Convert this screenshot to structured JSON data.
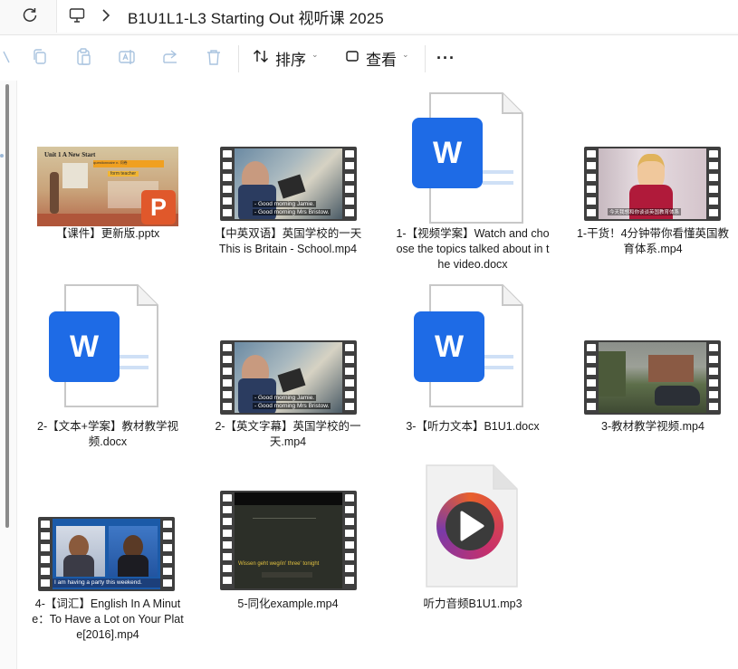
{
  "address": {
    "path": "B1U1L1-L3  Starting Out 视听课 2025"
  },
  "toolbar": {
    "sort_label": "排序",
    "view_label": "查看",
    "more_label": "···"
  },
  "files": [
    {
      "name": "【课件】更新版.pptx",
      "type": "pptx",
      "thumb_icon": "powerpoint-thumbnail",
      "thumb_text": {
        "title": "Unit 1 A New Start",
        "highlight": "questionnaire n. 问卷",
        "heading": "form teacher"
      }
    },
    {
      "name": "【中英双语】英国学校的一天 This is Britain - School.mp4",
      "type": "mp4",
      "subs": [
        "- Good morning Jamie.",
        "- Good morning Mrs Bristow."
      ]
    },
    {
      "name": "1-【视频学案】Watch and choose the topics talked about in the video.docx",
      "type": "docx"
    },
    {
      "name": "1-干货！4分钟带你看懂英国教育体系.mp4",
      "type": "mp4",
      "subs": [
        "今天我想和你谈谈英国教育体系"
      ]
    },
    {
      "name": "2-【文本+学案】教材教学视频.docx",
      "type": "docx"
    },
    {
      "name": "2-【英文字幕】英国学校的一天.mp4",
      "type": "mp4",
      "subs": [
        "- Good morning Jamie.",
        "- Good morning Mrs Bristow."
      ]
    },
    {
      "name": "3-【听力文本】B1U1.docx",
      "type": "docx"
    },
    {
      "name": "3-教材教学视频.mp4",
      "type": "mp4"
    },
    {
      "name": "4-【词汇】English In A Minute：To Have a Lot on Your Plate[2016].mp4",
      "type": "mp4",
      "subs": [
        "I am having a party this weekend."
      ]
    },
    {
      "name": "5-同化example.mp4",
      "type": "mp4",
      "subs": [
        "Wissen geht weg/in' three' tonight"
      ]
    },
    {
      "name": "听力音频B1U1.mp3",
      "type": "mp3"
    }
  ],
  "colors": {
    "word_blue": "#1e6be6",
    "ppt_orange": "#e0582b",
    "film_dark": "#3f3f3f"
  }
}
